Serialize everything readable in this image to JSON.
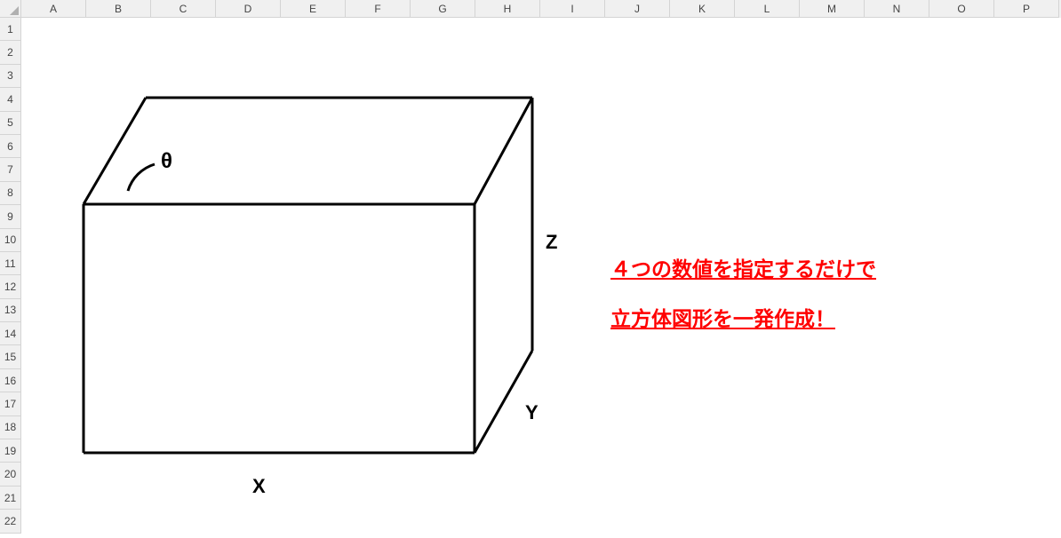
{
  "columns": [
    "A",
    "B",
    "C",
    "D",
    "E",
    "F",
    "G",
    "H",
    "I",
    "J",
    "K",
    "L",
    "M",
    "N",
    "O",
    "P"
  ],
  "rows": [
    "1",
    "2",
    "3",
    "4",
    "5",
    "6",
    "7",
    "8",
    "9",
    "10",
    "11",
    "12",
    "13",
    "14",
    "15",
    "16",
    "17",
    "18",
    "19",
    "20",
    "21",
    "22"
  ],
  "cube": {
    "labels": {
      "theta": "θ",
      "x": "X",
      "y": "Y",
      "z": "Z"
    }
  },
  "callout": {
    "line1": "４つの数値を指定するだけで",
    "line2": "立方体図形を一発作成！"
  }
}
